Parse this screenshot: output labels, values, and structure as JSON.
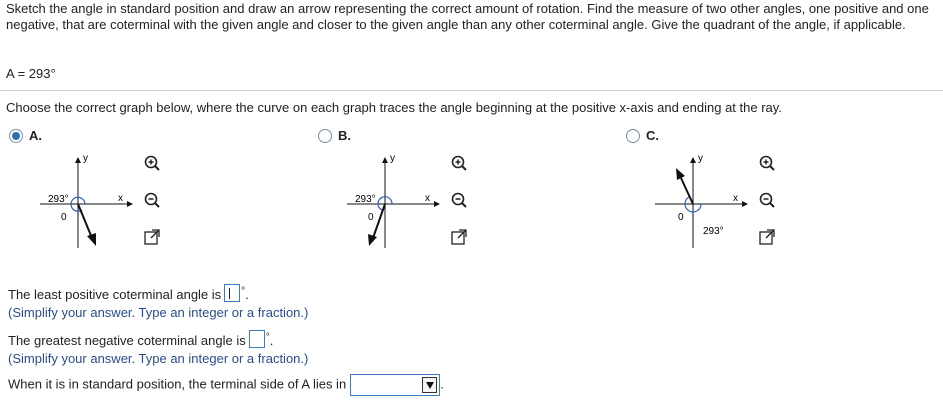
{
  "question": "Sketch the angle in standard position and draw an arrow representing the correct amount of rotation. Find the measure of two other angles, one positive and one negative, that are coterminal with the given angle and closer to the given angle than any other coterminal angle. Give the quadrant of the angle, if applicable.",
  "given": "A = 293°",
  "prompt": "Choose the correct graph below, where the curve on each graph traces the angle beginning at the positive x-axis and ending at the ray.",
  "options": [
    {
      "label": "A.",
      "selected": true
    },
    {
      "label": "B.",
      "selected": false
    },
    {
      "label": "C.",
      "selected": false
    }
  ],
  "graph_labels": {
    "x": "x",
    "y": "y",
    "origin": "0",
    "angle": "293°"
  },
  "icons": [
    "zoom-in-icon",
    "zoom-out-icon",
    "expand-icon"
  ],
  "answers": {
    "least_positive_label": "The least positive coterminal angle is",
    "greatest_negative_label": "The greatest negative coterminal angle is",
    "hint": "(Simplify your answer. Type an integer or a fraction.)",
    "degree_symbol": "°",
    "period": ".",
    "quadrant_label": "When it is in standard position, the terminal side of A lies in",
    "quadrant_value": ""
  },
  "colors": {
    "radio_selected": "#2f6fb4",
    "arc": "#2f5fb8",
    "input_border": "#3a7bc8",
    "hint": "#2a4d8f"
  }
}
